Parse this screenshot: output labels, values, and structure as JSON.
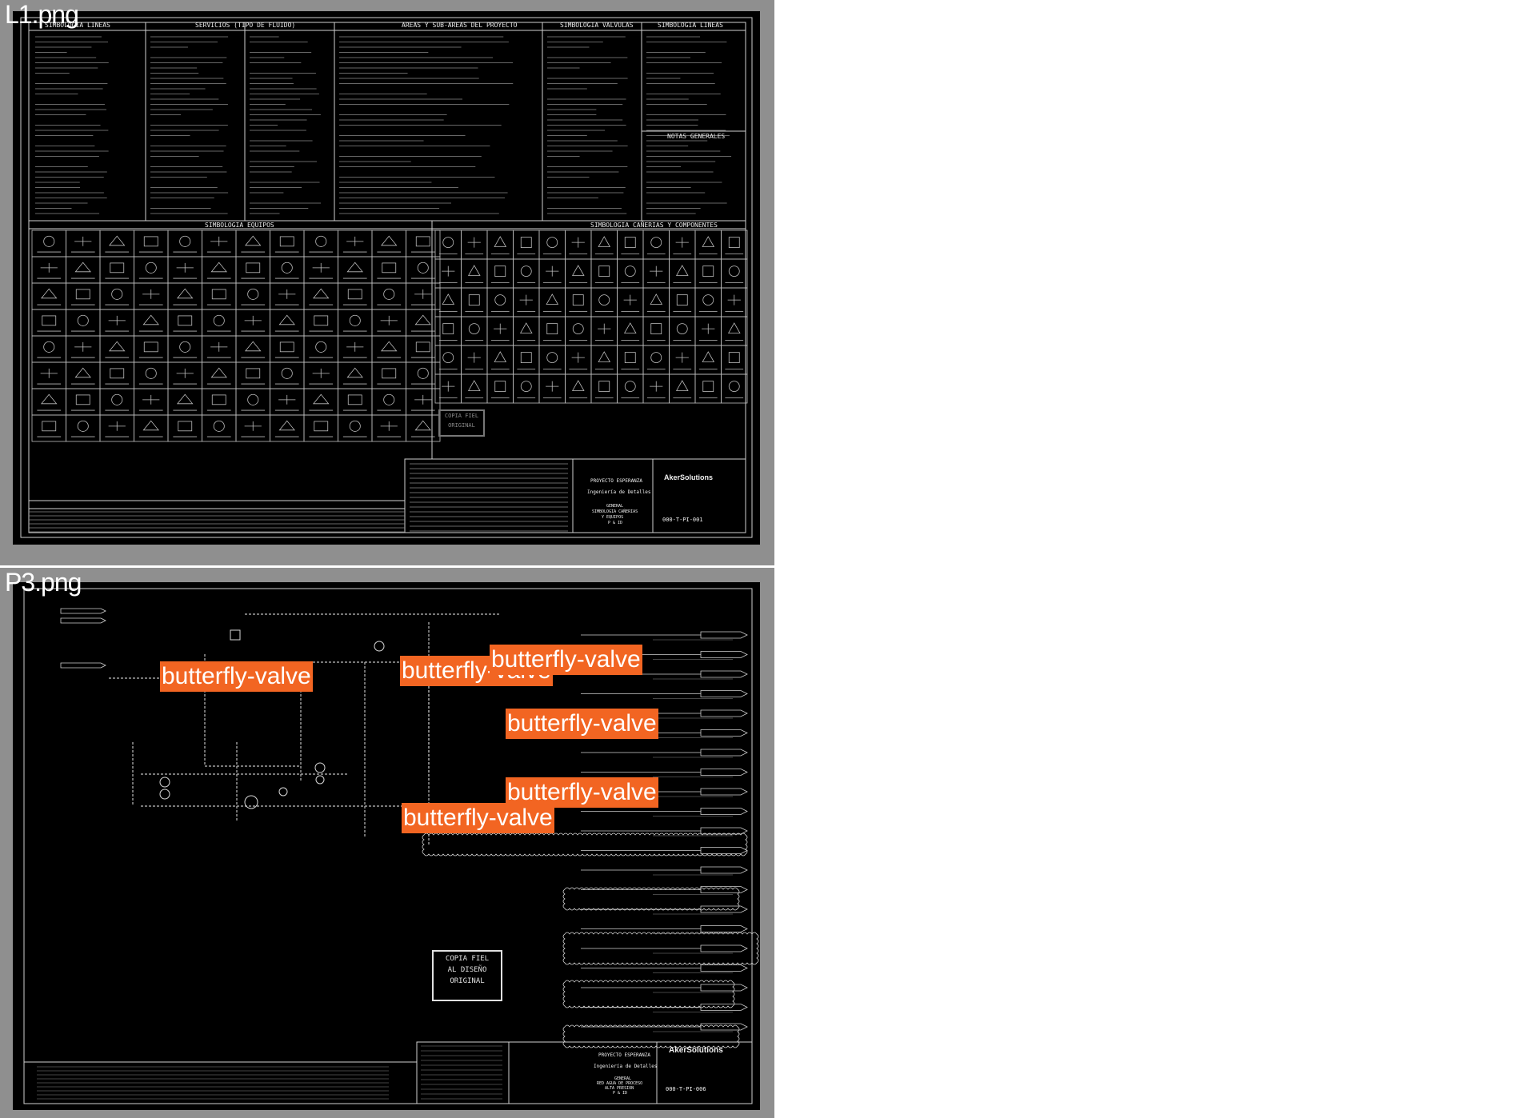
{
  "panels": [
    {
      "title": "L1.png",
      "headers": {
        "simbologia_lineas": "SIMBOLOGIA LINEAS",
        "servicios": "SERVICIOS (TIPO DE FLUIDO)",
        "areas": "AREAS Y SUB-AREAS DEL PROYECTO",
        "simbologia_valvulas": "SIMBOLOGIA VALVULAS",
        "simbologia_lineas_2": "SIMBOLOGIA LINEAS",
        "notas_generales": "NOTAS GENERALES",
        "simbologia_equipos": "SIMBOLOGIA EQUIPOS",
        "simbologia_canerias": "SIMBOLOGIA CAÑERIAS Y COMPONENTES"
      },
      "title_block": {
        "project": "PROYECTO ESPERANZA",
        "subtitle": "Ingeniería de Detalles",
        "doc_title_1": "GENERAL",
        "doc_title_2": "SIMBOLOGIA CAÑERIAS",
        "doc_title_3": "Y EQUIPOS",
        "doc_title_4": "P & ID",
        "company": "AkerSolutions",
        "drawing_number": "000-T-PI-001"
      },
      "stamp": [
        "COPIA FIEL",
        "ORIGINAL"
      ]
    },
    {
      "title": "P3.png",
      "title_block": {
        "project": "PROYECTO ESPERANZA",
        "subtitle": "Ingeniería de Detalles",
        "doc_title_1": "GENERAL",
        "doc_title_2": "RED AGUA DE PROCESO",
        "doc_title_3": "ALTA PRESION",
        "doc_title_4": "P & ID",
        "company": "AkerSolutions",
        "drawing_number": "000-T-PI-006"
      },
      "stamp": [
        "COPIA FIEL",
        "AL DISEÑO",
        "ORIGINAL"
      ],
      "labels": [
        "butterfly-valve",
        "butterfly-valve",
        "butterfly-valve",
        "butterfly-valve",
        "butterfly-valve",
        "butterfly-valve"
      ]
    }
  ],
  "colors": {
    "panel_bg": "#8f8f8f",
    "sheet_bg": "#000000",
    "line": "#d8d8d8",
    "label_bg": "#f26522"
  }
}
